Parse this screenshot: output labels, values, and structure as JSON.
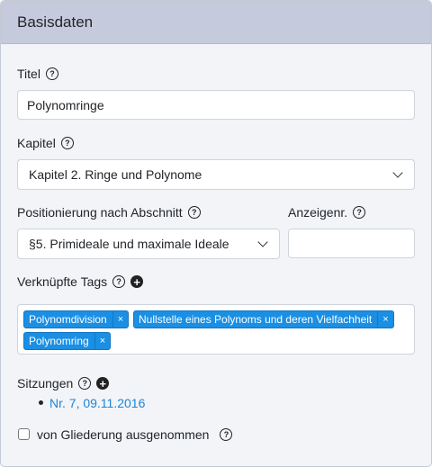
{
  "header": {
    "title": "Basisdaten"
  },
  "titel": {
    "label": "Titel",
    "value": "Polynomringe"
  },
  "kapitel": {
    "label": "Kapitel",
    "selected": "Kapitel 2. Ringe und Polynome"
  },
  "positionierung": {
    "label": "Positionierung nach Abschnitt",
    "selected": "§5. Primideale und maximale Ideale"
  },
  "anzeigenr": {
    "label": "Anzeigenr.",
    "value": ""
  },
  "tags": {
    "label": "Verknüpfte Tags",
    "items": [
      {
        "label": "Polynomdivision",
        "remove": "×"
      },
      {
        "label": "Nullstelle eines Polynoms und deren Vielfachheit",
        "remove": "×"
      },
      {
        "label": "Polynomring",
        "remove": "×"
      }
    ]
  },
  "sitzungen": {
    "label": "Sitzungen",
    "items": [
      {
        "label": "Nr. 7, 09.11.2016"
      }
    ]
  },
  "gliederung": {
    "label": "von Gliederung ausgenommen",
    "checked": false
  },
  "icons": {
    "help": "question-circle-icon",
    "add": "plus-circle-icon"
  },
  "colors": {
    "header_bg": "#c5cbdc",
    "card_bg": "#f2f4f8",
    "tag_bg": "#1a8fe3",
    "link": "#1a86d8"
  }
}
